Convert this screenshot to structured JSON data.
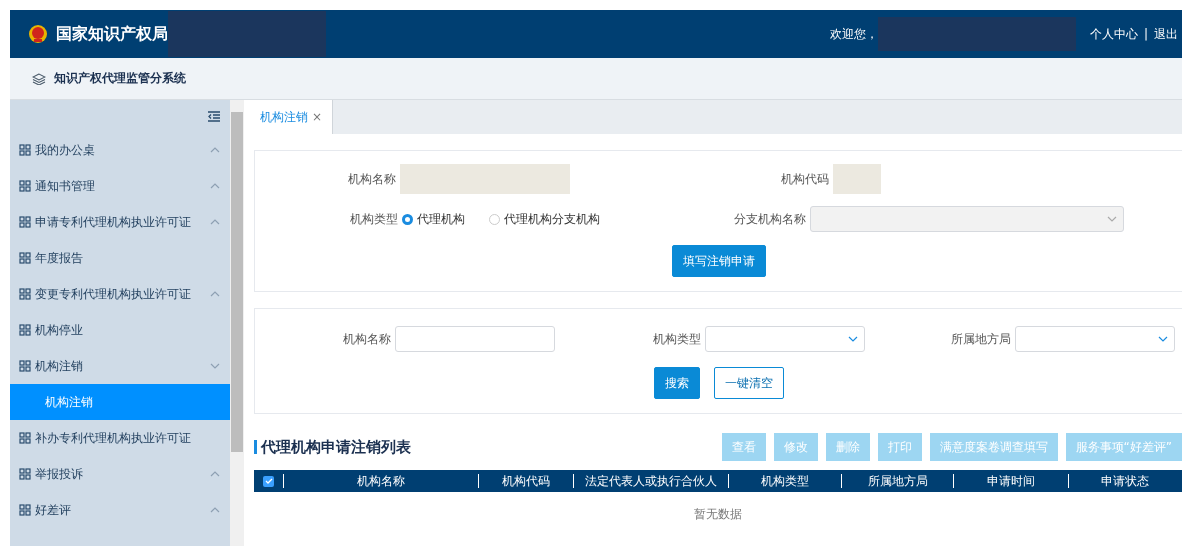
{
  "header": {
    "title": "国家知识产权局",
    "welcome": "欢迎您，",
    "links": [
      "个人中心",
      "退出"
    ],
    "separator": "|"
  },
  "subheader": {
    "title": "知识产权代理监管分系统"
  },
  "sidebar": {
    "items": [
      {
        "label": "我的办公桌",
        "expanded": false
      },
      {
        "label": "通知书管理",
        "expanded": false
      },
      {
        "label": "申请专利代理机构执业许可证",
        "expanded": false
      },
      {
        "label": "年度报告"
      },
      {
        "label": "变更专利代理机构执业许可证",
        "expanded": false
      },
      {
        "label": "机构停业"
      },
      {
        "label": "机构注销",
        "expanded": true,
        "children": [
          {
            "label": "机构注销",
            "selected": true
          }
        ]
      },
      {
        "label": "补办专利代理机构执业许可证"
      },
      {
        "label": "举报投诉",
        "expanded": false
      },
      {
        "label": "好差评",
        "expanded": false
      }
    ]
  },
  "tabs": [
    {
      "label": "机构注销",
      "selected": true,
      "close": "×"
    }
  ],
  "apply_form": {
    "name_label": "机构名称",
    "code_label": "机构代码",
    "type_label": "机构类型",
    "type_options": [
      {
        "label": "代理机构",
        "selected": true
      },
      {
        "label": "代理机构分支机构",
        "selected": false
      }
    ],
    "branch_label": "分支机构名称",
    "branch_disabled": true,
    "submit": "填写注销申请"
  },
  "search_form": {
    "fields": [
      {
        "label": "机构名称",
        "kind": "text"
      },
      {
        "label": "机构类型",
        "kind": "select"
      },
      {
        "label": "所属地方局",
        "kind": "select"
      }
    ],
    "search": "搜索",
    "clear": "一键清空"
  },
  "list": {
    "title": "代理机构申请注销列表",
    "actions": [
      {
        "label": "查看",
        "disabled": true
      },
      {
        "label": "修改",
        "disabled": true
      },
      {
        "label": "删除",
        "disabled": true
      },
      {
        "label": "打印",
        "disabled": true
      },
      {
        "label": "满意度案卷调查填写",
        "disabled": true
      },
      {
        "label": "服务事项“好差评”",
        "disabled": true
      }
    ],
    "select_all": true,
    "columns": [
      "机构名称",
      "机构代码",
      "法定代表人或执行合伙人",
      "机构类型",
      "所属地方局",
      "申请时间",
      "申请状态"
    ],
    "empty": "暂无数据"
  }
}
